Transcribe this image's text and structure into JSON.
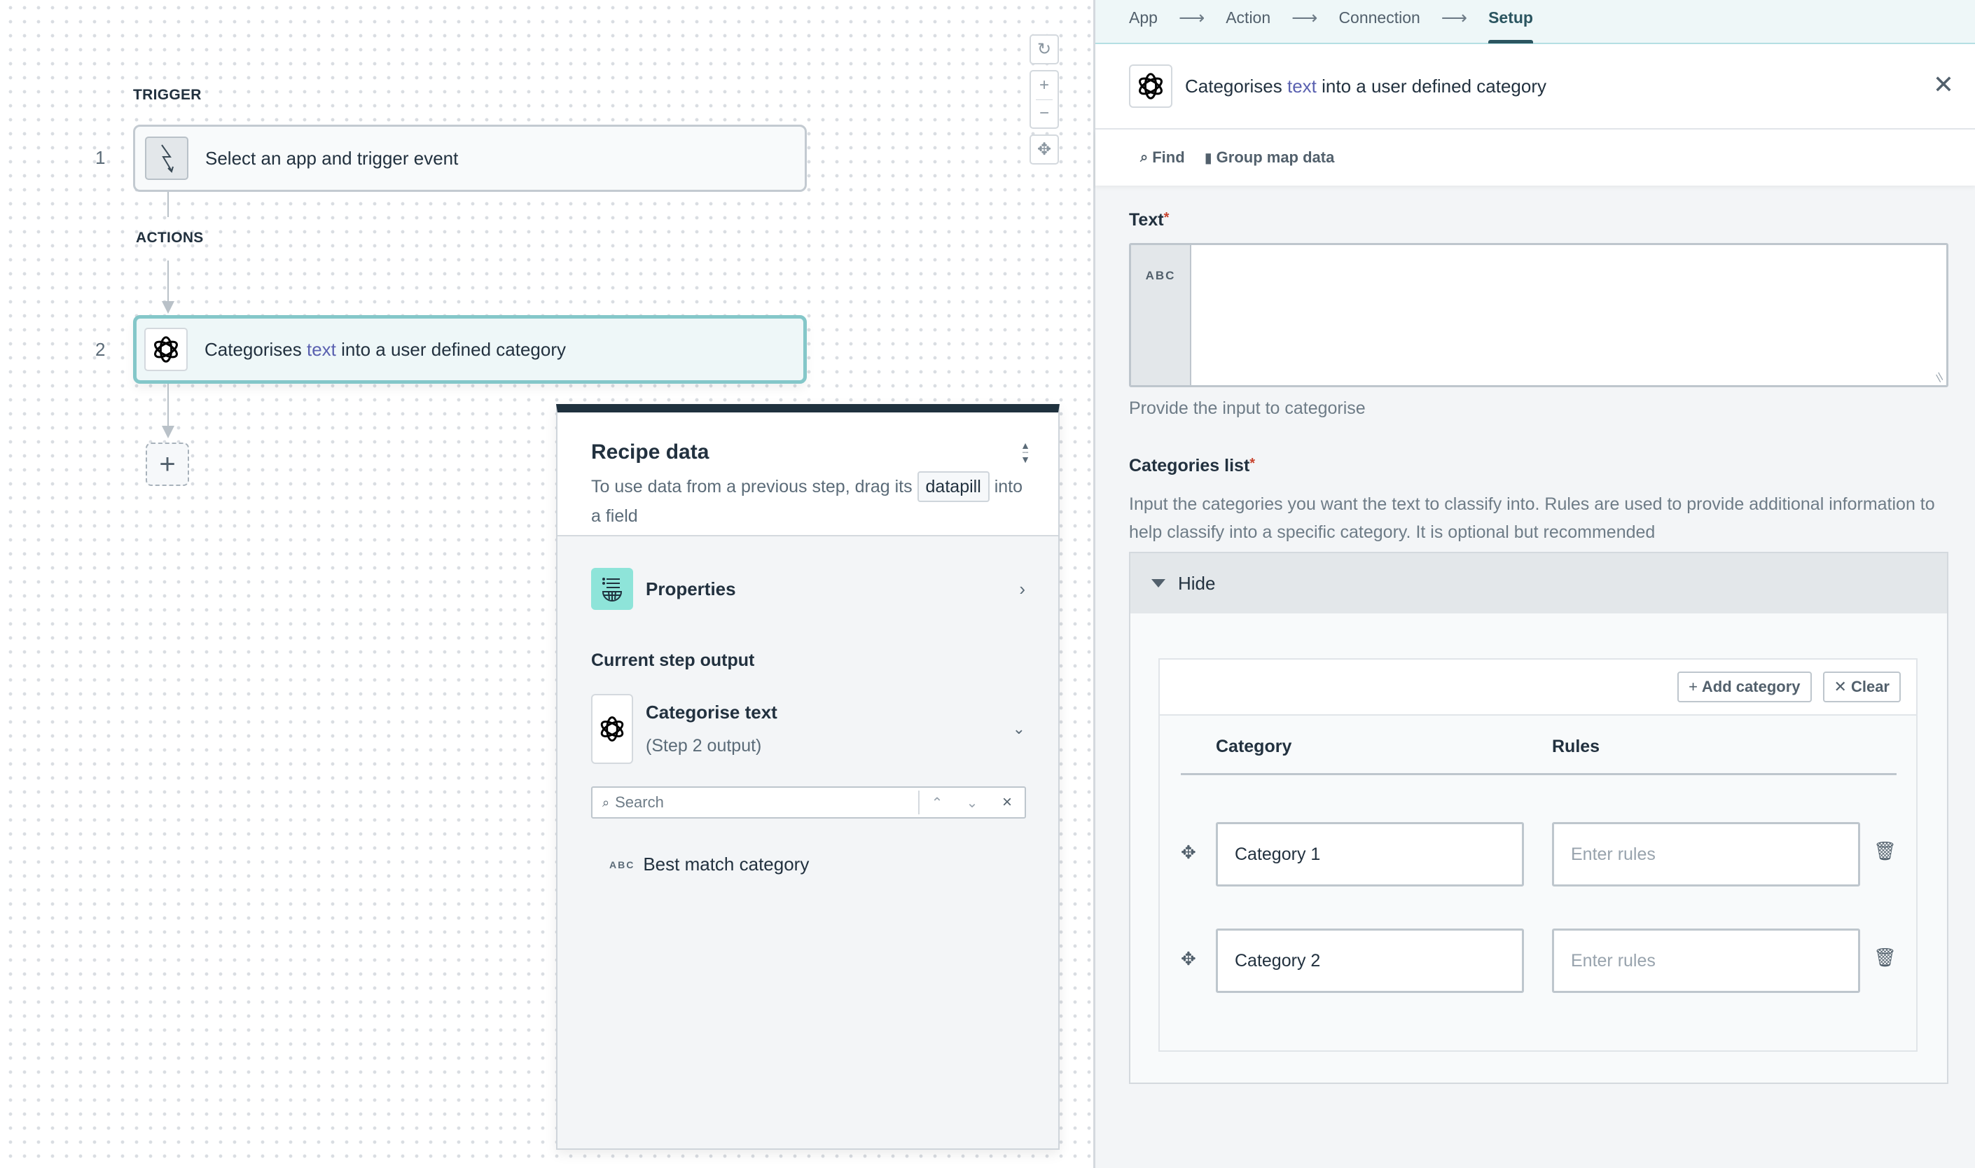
{
  "canvas": {
    "trigger_label": "TRIGGER",
    "actions_label": "ACTIONS",
    "steps": [
      {
        "number": "1",
        "text": "Select an app and trigger event",
        "icon": "lightning-icon"
      },
      {
        "number": "2",
        "text_before": "Categorises ",
        "text_highlight": "text",
        "text_after": " into a user defined category",
        "icon": "openai-icon"
      }
    ],
    "add_step": "+",
    "controls": {
      "reset": "↻",
      "zoom_in": "+",
      "zoom_out": "−",
      "fit": "✥"
    }
  },
  "recipe_data": {
    "title": "Recipe data",
    "subtitle_before": "To use data from a previous step, drag its",
    "pill": "datapill",
    "subtitle_after": "into a field",
    "properties_label": "Properties",
    "current_step_output_label": "Current step output",
    "step_output_name": "Categorise text",
    "step_output_sub": "(Step 2 output)",
    "search_placeholder": "Search",
    "output_items": [
      {
        "type": "ABC",
        "label": "Best match category"
      }
    ]
  },
  "wizard": {
    "steps": [
      "App",
      "Action",
      "Connection",
      "Setup"
    ],
    "active": "Setup",
    "arrow": "⟶"
  },
  "panel": {
    "title_before": "Categorises ",
    "title_highlight": "text",
    "title_after": " into a user defined category",
    "toolbar": {
      "find": "Find",
      "group_map": "Group map data"
    },
    "text_field": {
      "label": "Text",
      "required": "*",
      "type": "ABC",
      "value": "",
      "hint": "Provide the input to categorise"
    },
    "categories": {
      "label": "Categories list",
      "required": "*",
      "description": "Input the categories you want the text to classify into. Rules are used to provide additional information to help classify into a specific category. It is optional but recommended",
      "toggle_label": "Hide",
      "add_button": "Add category",
      "clear_button": "Clear",
      "col_category": "Category",
      "col_rules": "Rules",
      "rows": [
        {
          "category": "Category 1",
          "rules_placeholder": "Enter rules"
        },
        {
          "category": "Category 2",
          "rules_placeholder": "Enter rules"
        }
      ]
    }
  },
  "colors": {
    "accent_teal": "#84c7c9",
    "highlight": "#5a61b0",
    "required": "#c8442f",
    "dark_header": "#1f313e"
  }
}
